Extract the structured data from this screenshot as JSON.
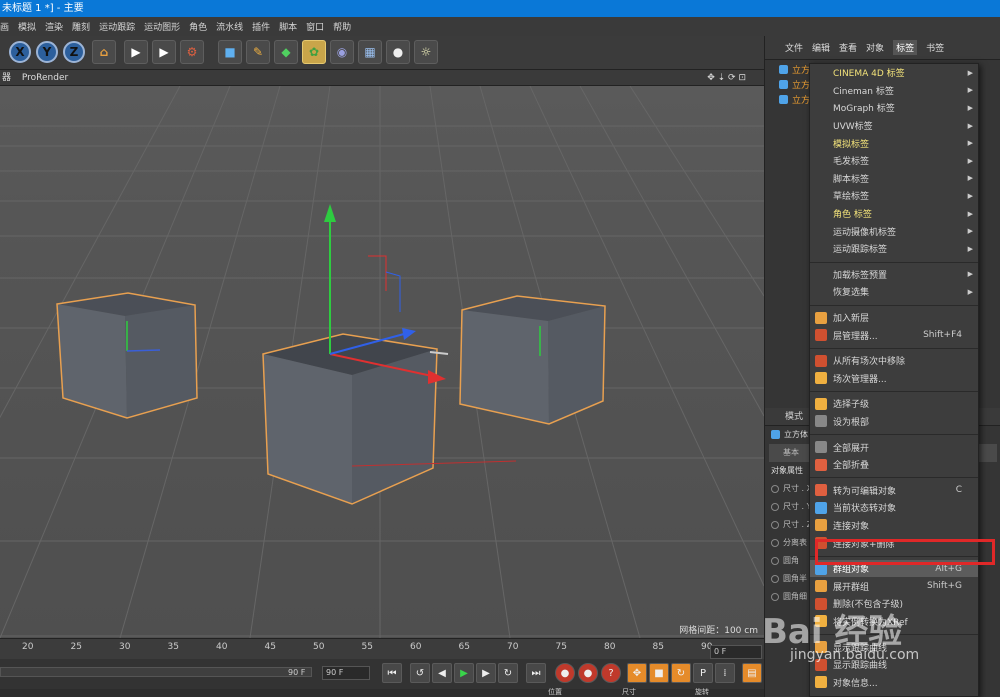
{
  "window": {
    "title": "未标题 1 *] - 主要"
  },
  "menubar": [
    "画",
    "模拟",
    "渲染",
    "雕刻",
    "运动跟踪",
    "运动图形",
    "角色",
    "流水线",
    "插件",
    "脚本",
    "窗口",
    "帮助"
  ],
  "viewport": {
    "tab_left": "器",
    "tab_render": "ProRender",
    "grid_info": "网格间距：100 cm"
  },
  "timeline": {
    "ticks": [
      "20",
      "25",
      "30",
      "35",
      "40",
      "45",
      "50",
      "55",
      "60",
      "65",
      "70",
      "75",
      "80",
      "85",
      "90"
    ],
    "frame_end": "90 F",
    "frame_end2": "90 F",
    "current_frame": "0 F"
  },
  "coords_labels": [
    "位置",
    "尺寸",
    "旋转"
  ],
  "object_manager": {
    "menu": [
      "文件",
      "编辑",
      "查看",
      "对象",
      "标签",
      "书签"
    ],
    "active_menu": "标签",
    "objects": [
      "立方",
      "立方",
      "立方"
    ]
  },
  "attributes": {
    "header": "模式",
    "object_name": "立方体",
    "tab_basic": "基本",
    "section": "对象属性",
    "rows": [
      "尺寸 . X",
      "尺寸 . Y",
      "尺寸 . Z",
      "分离表",
      "圆角",
      "圆角半",
      "圆角细"
    ]
  },
  "context_menu": {
    "group1": [
      {
        "label": "CINEMA 4D 标签",
        "highlight": true,
        "submenu": true
      },
      {
        "label": "Cineman 标签",
        "highlight": false,
        "submenu": true
      },
      {
        "label": "MoGraph 标签",
        "highlight": false,
        "submenu": true
      },
      {
        "label": "UVW标签",
        "highlight": false,
        "submenu": true
      },
      {
        "label": "模拟标签",
        "highlight": true,
        "submenu": true
      },
      {
        "label": "毛发标签",
        "highlight": false,
        "submenu": true
      },
      {
        "label": "脚本标签",
        "highlight": false,
        "submenu": true
      },
      {
        "label": "草绘标签",
        "highlight": false,
        "submenu": true
      },
      {
        "label": "角色 标签",
        "highlight": true,
        "submenu": true
      },
      {
        "label": "运动摄像机标签",
        "highlight": false,
        "submenu": true
      },
      {
        "label": "运动跟踪标签",
        "highlight": false,
        "submenu": true
      }
    ],
    "group2": [
      {
        "label": "加载标签预置",
        "submenu": true
      },
      {
        "label": "恢复选集",
        "submenu": true
      }
    ],
    "group3": [
      {
        "label": "加入新层",
        "shortcut": ""
      },
      {
        "label": "层管理器...",
        "shortcut": "Shift+F4"
      }
    ],
    "group4": [
      {
        "label": "从所有场次中移除",
        "shortcut": ""
      },
      {
        "label": "场次管理器...",
        "shortcut": ""
      }
    ],
    "group5": [
      {
        "label": "选择子级",
        "shortcut": ""
      },
      {
        "label": "设为根部",
        "shortcut": ""
      }
    ],
    "group6": [
      {
        "label": "全部展开",
        "shortcut": ""
      },
      {
        "label": "全部折叠",
        "shortcut": ""
      }
    ],
    "group7": [
      {
        "label": "转为可编辑对象",
        "shortcut": "C"
      },
      {
        "label": "当前状态转对象",
        "shortcut": ""
      },
      {
        "label": "连接对象",
        "shortcut": ""
      },
      {
        "label": "连接对象+删除",
        "shortcut": ""
      }
    ],
    "group8": [
      {
        "label": "群组对象",
        "shortcut": "Alt+G"
      },
      {
        "label": "展开群组",
        "shortcut": "Shift+G"
      },
      {
        "label": "删除(不包含子级)",
        "shortcut": ""
      },
      {
        "label": "将实例转换为XRef",
        "shortcut": ""
      }
    ],
    "group9": [
      {
        "label": "显示跟踪曲线",
        "shortcut": ""
      },
      {
        "label": "显示跟踪曲线",
        "shortcut": ""
      },
      {
        "label": "对象信息...",
        "shortcut": ""
      }
    ]
  },
  "watermark": {
    "main": "Bai 经验",
    "sub": "jingyan.baidu.com"
  },
  "colors": {
    "title_bar": "#0a78d7",
    "highlight_red": "#e02828",
    "object_orange": "#f0a030",
    "menu_highlight": "#f2e27a"
  }
}
